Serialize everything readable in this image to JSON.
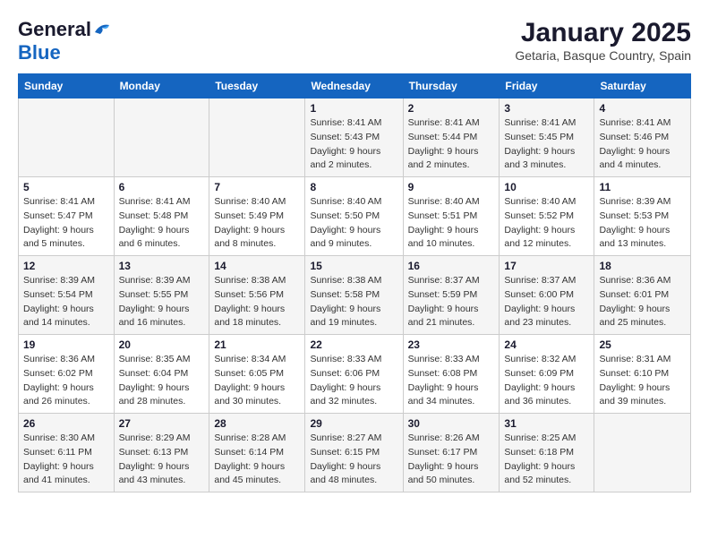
{
  "logo": {
    "general": "General",
    "blue": "Blue"
  },
  "title": "January 2025",
  "subtitle": "Getaria, Basque Country, Spain",
  "headers": [
    "Sunday",
    "Monday",
    "Tuesday",
    "Wednesday",
    "Thursday",
    "Friday",
    "Saturday"
  ],
  "weeks": [
    [
      {
        "day": "",
        "sunrise": "",
        "sunset": "",
        "daylight": ""
      },
      {
        "day": "",
        "sunrise": "",
        "sunset": "",
        "daylight": ""
      },
      {
        "day": "",
        "sunrise": "",
        "sunset": "",
        "daylight": ""
      },
      {
        "day": "1",
        "sunrise": "Sunrise: 8:41 AM",
        "sunset": "Sunset: 5:43 PM",
        "daylight": "Daylight: 9 hours and 2 minutes."
      },
      {
        "day": "2",
        "sunrise": "Sunrise: 8:41 AM",
        "sunset": "Sunset: 5:44 PM",
        "daylight": "Daylight: 9 hours and 2 minutes."
      },
      {
        "day": "3",
        "sunrise": "Sunrise: 8:41 AM",
        "sunset": "Sunset: 5:45 PM",
        "daylight": "Daylight: 9 hours and 3 minutes."
      },
      {
        "day": "4",
        "sunrise": "Sunrise: 8:41 AM",
        "sunset": "Sunset: 5:46 PM",
        "daylight": "Daylight: 9 hours and 4 minutes."
      }
    ],
    [
      {
        "day": "5",
        "sunrise": "Sunrise: 8:41 AM",
        "sunset": "Sunset: 5:47 PM",
        "daylight": "Daylight: 9 hours and 5 minutes."
      },
      {
        "day": "6",
        "sunrise": "Sunrise: 8:41 AM",
        "sunset": "Sunset: 5:48 PM",
        "daylight": "Daylight: 9 hours and 6 minutes."
      },
      {
        "day": "7",
        "sunrise": "Sunrise: 8:40 AM",
        "sunset": "Sunset: 5:49 PM",
        "daylight": "Daylight: 9 hours and 8 minutes."
      },
      {
        "day": "8",
        "sunrise": "Sunrise: 8:40 AM",
        "sunset": "Sunset: 5:50 PM",
        "daylight": "Daylight: 9 hours and 9 minutes."
      },
      {
        "day": "9",
        "sunrise": "Sunrise: 8:40 AM",
        "sunset": "Sunset: 5:51 PM",
        "daylight": "Daylight: 9 hours and 10 minutes."
      },
      {
        "day": "10",
        "sunrise": "Sunrise: 8:40 AM",
        "sunset": "Sunset: 5:52 PM",
        "daylight": "Daylight: 9 hours and 12 minutes."
      },
      {
        "day": "11",
        "sunrise": "Sunrise: 8:39 AM",
        "sunset": "Sunset: 5:53 PM",
        "daylight": "Daylight: 9 hours and 13 minutes."
      }
    ],
    [
      {
        "day": "12",
        "sunrise": "Sunrise: 8:39 AM",
        "sunset": "Sunset: 5:54 PM",
        "daylight": "Daylight: 9 hours and 14 minutes."
      },
      {
        "day": "13",
        "sunrise": "Sunrise: 8:39 AM",
        "sunset": "Sunset: 5:55 PM",
        "daylight": "Daylight: 9 hours and 16 minutes."
      },
      {
        "day": "14",
        "sunrise": "Sunrise: 8:38 AM",
        "sunset": "Sunset: 5:56 PM",
        "daylight": "Daylight: 9 hours and 18 minutes."
      },
      {
        "day": "15",
        "sunrise": "Sunrise: 8:38 AM",
        "sunset": "Sunset: 5:58 PM",
        "daylight": "Daylight: 9 hours and 19 minutes."
      },
      {
        "day": "16",
        "sunrise": "Sunrise: 8:37 AM",
        "sunset": "Sunset: 5:59 PM",
        "daylight": "Daylight: 9 hours and 21 minutes."
      },
      {
        "day": "17",
        "sunrise": "Sunrise: 8:37 AM",
        "sunset": "Sunset: 6:00 PM",
        "daylight": "Daylight: 9 hours and 23 minutes."
      },
      {
        "day": "18",
        "sunrise": "Sunrise: 8:36 AM",
        "sunset": "Sunset: 6:01 PM",
        "daylight": "Daylight: 9 hours and 25 minutes."
      }
    ],
    [
      {
        "day": "19",
        "sunrise": "Sunrise: 8:36 AM",
        "sunset": "Sunset: 6:02 PM",
        "daylight": "Daylight: 9 hours and 26 minutes."
      },
      {
        "day": "20",
        "sunrise": "Sunrise: 8:35 AM",
        "sunset": "Sunset: 6:04 PM",
        "daylight": "Daylight: 9 hours and 28 minutes."
      },
      {
        "day": "21",
        "sunrise": "Sunrise: 8:34 AM",
        "sunset": "Sunset: 6:05 PM",
        "daylight": "Daylight: 9 hours and 30 minutes."
      },
      {
        "day": "22",
        "sunrise": "Sunrise: 8:33 AM",
        "sunset": "Sunset: 6:06 PM",
        "daylight": "Daylight: 9 hours and 32 minutes."
      },
      {
        "day": "23",
        "sunrise": "Sunrise: 8:33 AM",
        "sunset": "Sunset: 6:08 PM",
        "daylight": "Daylight: 9 hours and 34 minutes."
      },
      {
        "day": "24",
        "sunrise": "Sunrise: 8:32 AM",
        "sunset": "Sunset: 6:09 PM",
        "daylight": "Daylight: 9 hours and 36 minutes."
      },
      {
        "day": "25",
        "sunrise": "Sunrise: 8:31 AM",
        "sunset": "Sunset: 6:10 PM",
        "daylight": "Daylight: 9 hours and 39 minutes."
      }
    ],
    [
      {
        "day": "26",
        "sunrise": "Sunrise: 8:30 AM",
        "sunset": "Sunset: 6:11 PM",
        "daylight": "Daylight: 9 hours and 41 minutes."
      },
      {
        "day": "27",
        "sunrise": "Sunrise: 8:29 AM",
        "sunset": "Sunset: 6:13 PM",
        "daylight": "Daylight: 9 hours and 43 minutes."
      },
      {
        "day": "28",
        "sunrise": "Sunrise: 8:28 AM",
        "sunset": "Sunset: 6:14 PM",
        "daylight": "Daylight: 9 hours and 45 minutes."
      },
      {
        "day": "29",
        "sunrise": "Sunrise: 8:27 AM",
        "sunset": "Sunset: 6:15 PM",
        "daylight": "Daylight: 9 hours and 48 minutes."
      },
      {
        "day": "30",
        "sunrise": "Sunrise: 8:26 AM",
        "sunset": "Sunset: 6:17 PM",
        "daylight": "Daylight: 9 hours and 50 minutes."
      },
      {
        "day": "31",
        "sunrise": "Sunrise: 8:25 AM",
        "sunset": "Sunset: 6:18 PM",
        "daylight": "Daylight: 9 hours and 52 minutes."
      },
      {
        "day": "",
        "sunrise": "",
        "sunset": "",
        "daylight": ""
      }
    ]
  ]
}
